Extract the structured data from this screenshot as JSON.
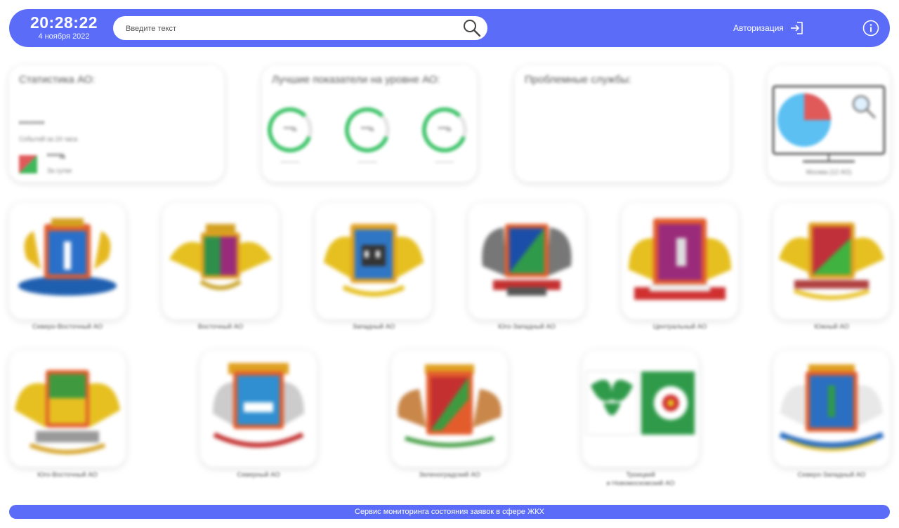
{
  "header": {
    "time": "20:28:22",
    "date": "4 ноября 2022",
    "search_placeholder": "Введите текст",
    "auth_label": "Авторизация",
    "accent_color": "#5b6cf8"
  },
  "icons": {
    "search": "search-icon",
    "auth": "login-arrow-icon",
    "info": "info-icon",
    "zoom": "magnifier-icon"
  },
  "cards": {
    "stats": {
      "title": "Статистика АО:",
      "count_masked": "*******",
      "count_caption": "Событий за 24 часа",
      "percent_masked": "***%",
      "percent_caption": "За сутки"
    },
    "best": {
      "title": "Лучшие показатели на уровне АО:",
      "rings": [
        {
          "value": "***%",
          "label": "———"
        },
        {
          "value": "***%",
          "label": "———"
        },
        {
          "value": "***%",
          "label": "———"
        }
      ]
    },
    "problem": {
      "title": "Проблемные службы:"
    },
    "moscow": {
      "caption": "Москва (12 АО)"
    }
  },
  "districts_row1": [
    {
      "label": "Северо-Восточный АО"
    },
    {
      "label": "Восточный АО"
    },
    {
      "label": "Западный АО"
    },
    {
      "label": "Юго-Западный АО"
    },
    {
      "label": "Центральный АО"
    },
    {
      "label": "Южный АО"
    }
  ],
  "districts_row2": [
    {
      "label": "Юго-Восточный АО"
    },
    {
      "label": "Северный АО"
    },
    {
      "label": "Зеленоградский АО"
    },
    {
      "label": "Троицкий"
    },
    {
      "label": "Северо-Западный АО"
    }
  ],
  "district_extra_line": "и Новомосковский АО",
  "footer": {
    "text": "Сервис мониторинга состояния заявок в сфере ЖКХ"
  }
}
